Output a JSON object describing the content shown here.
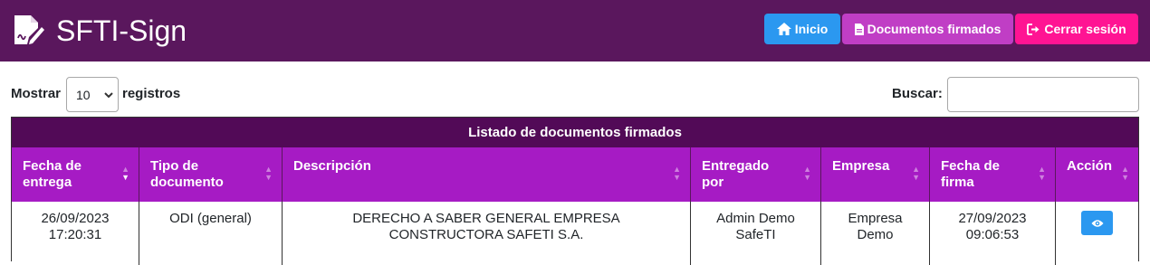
{
  "header": {
    "brand_icon": "signed-document-icon",
    "title": "SFTI-Sign",
    "buttons": [
      {
        "label": "Inicio",
        "icon": "home-icon",
        "color": "#2b98f0"
      },
      {
        "label": "Documentos firmados",
        "icon": "file-icon",
        "color": "#c03ec5"
      },
      {
        "label": "Cerrar sesión",
        "icon": "sign-out-icon",
        "color": "#ff1493"
      }
    ],
    "background": "#5a175d"
  },
  "controls": {
    "show_label": "Mostrar",
    "show_value": "10",
    "records_label": "registros",
    "search_label": "Buscar:",
    "search_value": ""
  },
  "table": {
    "title": "Listado de documentos firmados",
    "title_color": "#520a57",
    "header_color": "#a61bc4",
    "columns": [
      {
        "label": "Fecha de entrega",
        "lines": [
          "Fecha de",
          "entrega"
        ],
        "sort": "desc"
      },
      {
        "label": "Tipo de documento",
        "lines": [
          "Tipo de",
          "documento"
        ],
        "sort": "none"
      },
      {
        "label": "Descripción",
        "lines": [
          "Descripción"
        ],
        "sort": "none"
      },
      {
        "label": "Entregado por",
        "lines": [
          "Entregado",
          "por"
        ],
        "sort": "none"
      },
      {
        "label": "Empresa",
        "lines": [
          "Empresa"
        ],
        "sort": "none"
      },
      {
        "label": "Fecha de firma",
        "lines": [
          "Fecha de",
          "firma"
        ],
        "sort": "none"
      },
      {
        "label": "Acción",
        "lines": [
          "Acción"
        ],
        "sort": "none"
      }
    ],
    "rows": [
      {
        "fecha_entrega": [
          "26/09/2023",
          "17:20:31"
        ],
        "tipo_documento": [
          "ODI (general)"
        ],
        "descripcion": [
          "DERECHO A SABER GENERAL EMPRESA",
          "CONSTRUCTORA SAFETI S.A."
        ],
        "entregado_por": [
          "Admin Demo",
          "SafeTI"
        ],
        "empresa": [
          "Empresa",
          "Demo"
        ],
        "fecha_firma": [
          "27/09/2023",
          "09:06:53"
        ],
        "accion_icon": "eye-icon"
      }
    ]
  }
}
